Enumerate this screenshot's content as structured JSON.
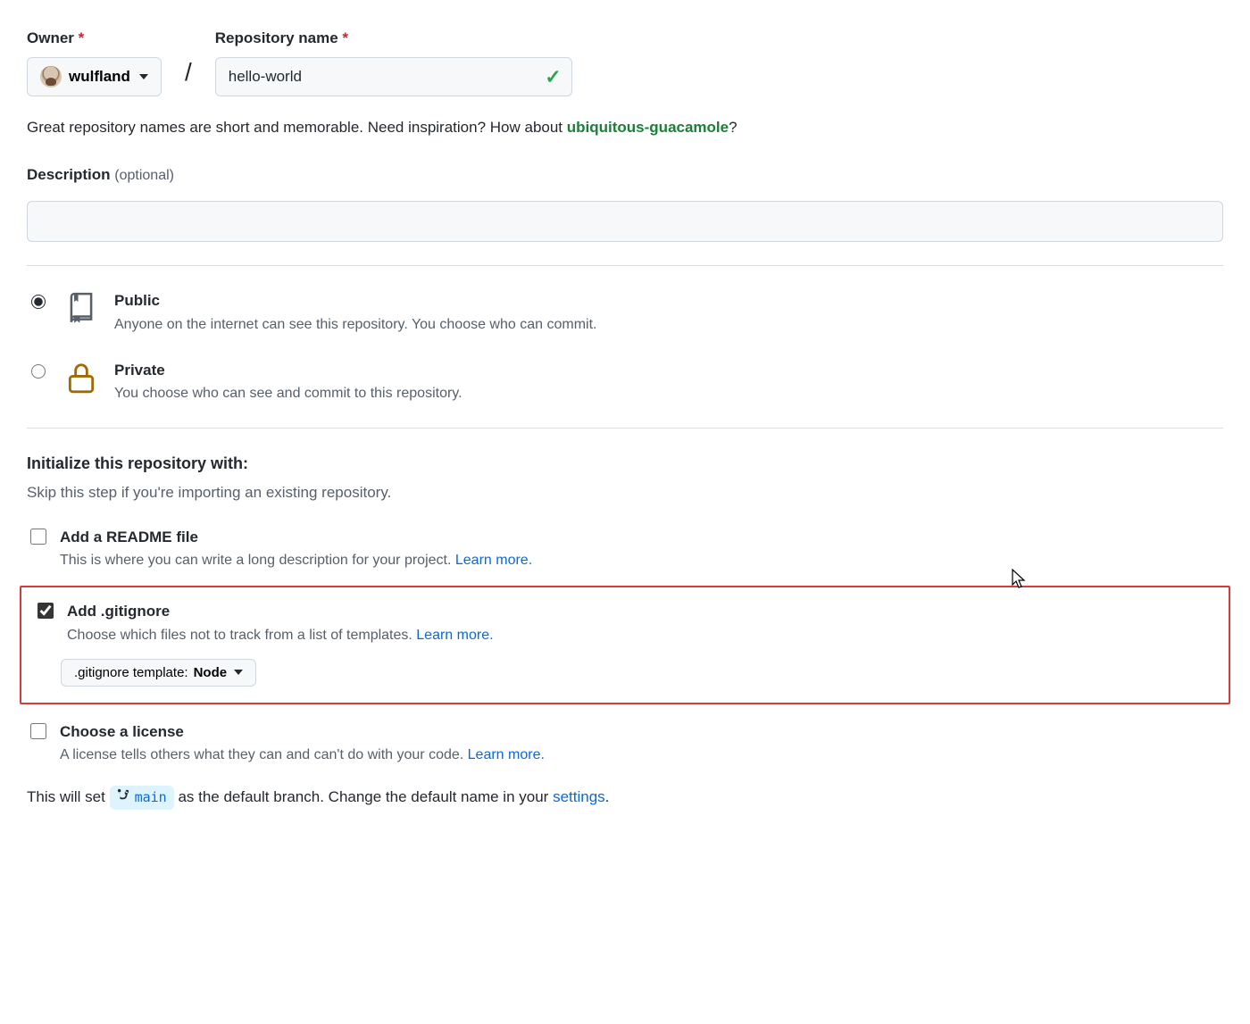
{
  "owner": {
    "label": "Owner",
    "selected": "wulfland"
  },
  "repo": {
    "label": "Repository name",
    "value": "hello-world"
  },
  "hint": {
    "text_a": "Great repository names are short and memorable. Need inspiration? How about ",
    "suggestion": "ubiquitous-guacamole",
    "qmark": "?"
  },
  "description": {
    "label": "Description",
    "optional": "(optional)"
  },
  "visibility": {
    "public": {
      "title": "Public",
      "sub": "Anyone on the internet can see this repository. You choose who can commit."
    },
    "private": {
      "title": "Private",
      "sub": "You choose who can see and commit to this repository."
    }
  },
  "init": {
    "heading": "Initialize this repository with:",
    "sub": "Skip this step if you're importing an existing repository."
  },
  "readme": {
    "title": "Add a README file",
    "sub": "This is where you can write a long description for your project. ",
    "learn": "Learn more."
  },
  "gitignore": {
    "title": "Add .gitignore",
    "sub": "Choose which files not to track from a list of templates. ",
    "learn": "Learn more.",
    "template_prefix": ".gitignore template: ",
    "template_value": "Node"
  },
  "license": {
    "title": "Choose a license",
    "sub": "A license tells others what they can and can't do with your code. ",
    "learn": "Learn more."
  },
  "footer": {
    "a": "This will set ",
    "branch": "main",
    "b": " as the default branch. Change the default name in your ",
    "settings": "settings",
    "period": "."
  }
}
